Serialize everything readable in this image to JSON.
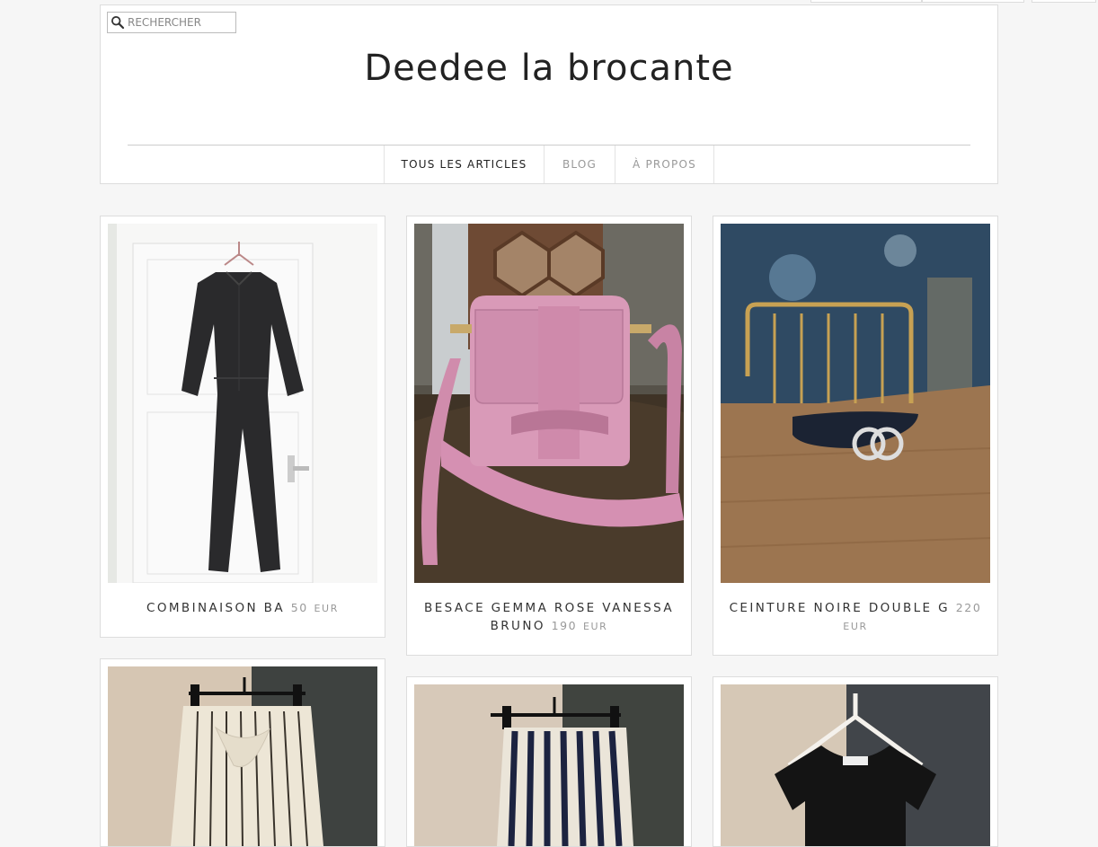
{
  "search": {
    "placeholder": "RECHERCHER",
    "icon": "magnifier-icon"
  },
  "site": {
    "title": "Deedee la brocante"
  },
  "nav": {
    "items": [
      {
        "label": "TOUS LES ARTICLES",
        "active": true
      },
      {
        "label": "BLOG",
        "active": false
      },
      {
        "label": "À PROPOS",
        "active": false
      }
    ]
  },
  "products": [
    {
      "name": "COMBINAISON BA",
      "price": "50",
      "currency": "EUR"
    },
    {
      "name": "BESACE GEMMA ROSE VANESSA BRUNO",
      "price": "190",
      "currency": "EUR"
    },
    {
      "name": "CEINTURE NOIRE DOUBLE G",
      "price": "220",
      "currency": "EUR"
    },
    {
      "name": "",
      "price": "",
      "currency": ""
    },
    {
      "name": "",
      "price": "",
      "currency": ""
    },
    {
      "name": "",
      "price": "",
      "currency": ""
    }
  ],
  "colors": {
    "background": "#f6f6f6",
    "text": "#222222",
    "muted": "#999999",
    "border": "#dddddd"
  }
}
